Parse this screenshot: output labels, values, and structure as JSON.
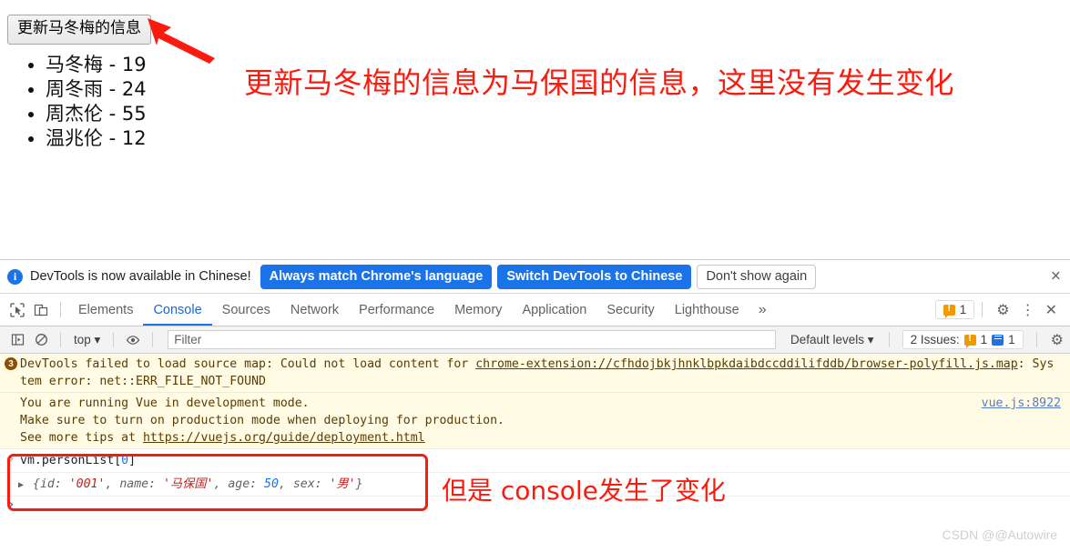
{
  "page": {
    "update_button_label": "更新马冬梅的信息",
    "person_list": [
      "马冬梅 - 19",
      "周冬雨 - 24",
      "周杰伦 - 55",
      "温兆伦 - 12"
    ]
  },
  "annotations": {
    "top": "更新马冬梅的信息为马保国的信息，这里没有发生变化",
    "bottom": "但是 console发生了变化",
    "color": "#fb1b0e"
  },
  "notification": {
    "icon": "info-icon",
    "message": "DevTools is now available in Chinese!",
    "primary_button": "Always match Chrome's language",
    "secondary_button": "Switch DevTools to Chinese",
    "dismiss_button": "Don't show again",
    "close_icon": "×",
    "primary_color": "#1a73e8"
  },
  "devtools": {
    "inspect_icon": "inspect-cursor-icon",
    "device_toolbar_icon": "device-toolbar-icon",
    "tabs": [
      {
        "label": "Elements",
        "active": false
      },
      {
        "label": "Console",
        "active": true
      },
      {
        "label": "Sources",
        "active": false
      },
      {
        "label": "Network",
        "active": false
      },
      {
        "label": "Performance",
        "active": false
      },
      {
        "label": "Memory",
        "active": false
      },
      {
        "label": "Application",
        "active": false
      },
      {
        "label": "Security",
        "active": false
      },
      {
        "label": "Lighthouse",
        "active": false
      }
    ],
    "more_tabs_icon": "»",
    "warning_chip_count": "1",
    "settings_icon": "gear-icon",
    "more_options_icon": "⋮",
    "close_icon": "✕",
    "active_tab_color": "#1a73e8"
  },
  "console_toolbar": {
    "sidebar_icon": "console-sidebar-icon",
    "clear_icon": "clear-console-icon",
    "context_selector": "top ▾",
    "eye_icon": "live-expression-icon",
    "filter_placeholder": "Filter",
    "levels_selector": "Default levels ▾",
    "issues_label": "2 Issues:",
    "issues_warning_count": "1",
    "issues_info_count": "1",
    "settings_icon": "gear-icon"
  },
  "console_messages": [
    {
      "badge": "3",
      "text_before": "DevTools failed to load source map: Could not load content for ",
      "link": "chrome-extension://cfhdojbkjhnklbpkdaibdccddilifddb/browser-polyfill.js.map",
      "text_after": ": System error: net::ERR_FILE_NOT_FOUND"
    }
  ],
  "vue_warning": {
    "line1": "You are running Vue in development mode.",
    "line2": "Make sure to turn on production mode when deploying for production.",
    "line3_prefix": "See more tips at ",
    "line3_link": "https://vuejs.org/guide/deployment.html",
    "source": "vue.js:8922"
  },
  "console_input": {
    "command_prefix": "vm.personList[",
    "command_index": "0",
    "command_suffix": "]",
    "result": {
      "open": "{",
      "fields": [
        {
          "key": "id",
          "value": "'001'",
          "type": "string"
        },
        {
          "key": "name",
          "value": "'马保国'",
          "type": "string"
        },
        {
          "key": "age",
          "value": "50",
          "type": "number"
        },
        {
          "key": "sex",
          "value": "'男'",
          "type": "string"
        }
      ],
      "close": "}"
    },
    "expand_icon": "▶",
    "prompt_icon": "›"
  },
  "watermark": "CSDN @@Autowire"
}
